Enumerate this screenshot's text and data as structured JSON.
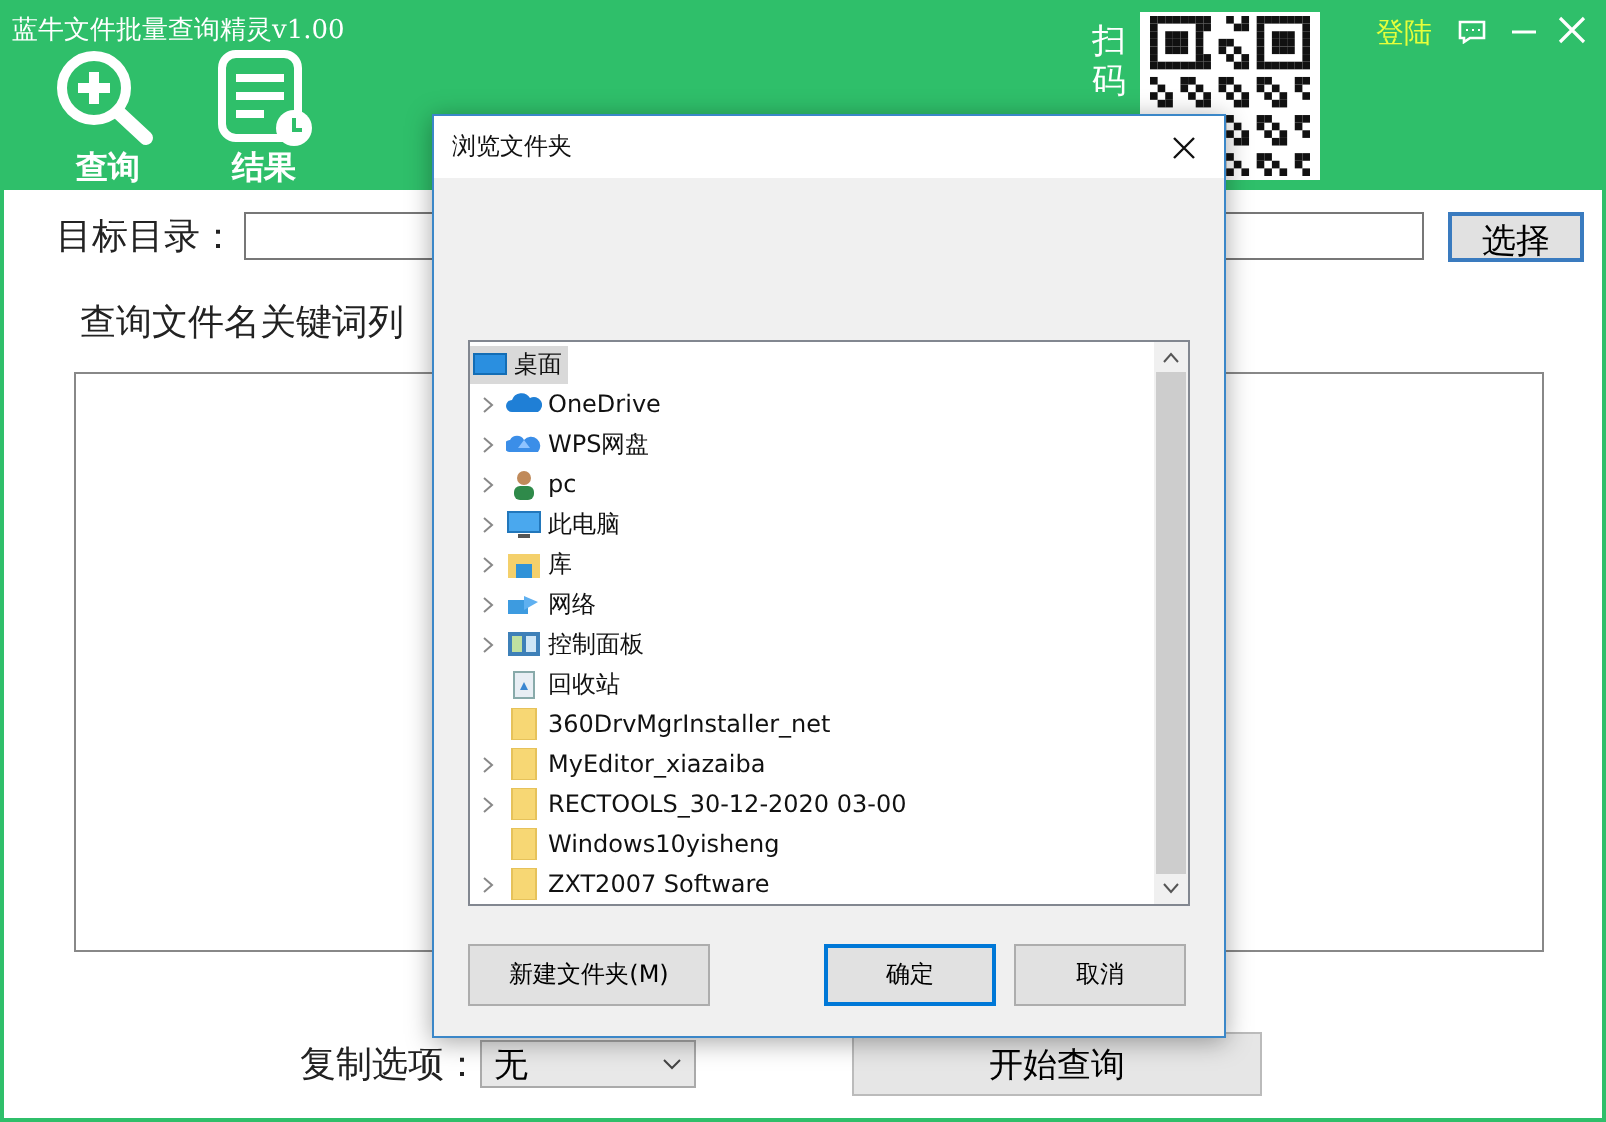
{
  "window": {
    "title": "蓝牛文件批量查询精灵v1.00",
    "login": "登陆"
  },
  "toolbar": [
    {
      "label": "查询",
      "kind": "search"
    },
    {
      "label": "结果",
      "kind": "result"
    }
  ],
  "qr_caption": "扫码",
  "target": {
    "label": "目标目录：",
    "button": "选择"
  },
  "keywords_label": "查询文件名关键词列",
  "copy_option": {
    "label": "复制选项：",
    "value": "无"
  },
  "start_button": "开始查询",
  "dialog": {
    "title": "浏览文件夹",
    "tree": {
      "label": "桌面",
      "kind": "desktop",
      "selected": true,
      "children": [
        {
          "label": "OneDrive",
          "kind": "cloud",
          "expandable": true,
          "selected": false
        },
        {
          "label": "WPS网盘",
          "kind": "cloud2",
          "expandable": true,
          "selected": false
        },
        {
          "label": "pc",
          "kind": "user",
          "expandable": true,
          "selected": false
        },
        {
          "label": "此电脑",
          "kind": "monitor",
          "expandable": true,
          "selected": false
        },
        {
          "label": "库",
          "kind": "library",
          "expandable": true,
          "selected": false
        },
        {
          "label": "网络",
          "kind": "network",
          "expandable": true,
          "selected": false
        },
        {
          "label": "控制面板",
          "kind": "panel",
          "expandable": true,
          "selected": false
        },
        {
          "label": "回收站",
          "kind": "bin",
          "expandable": false,
          "selected": false
        },
        {
          "label": "360DrvMgrInstaller_net",
          "kind": "folder",
          "expandable": false,
          "selected": false
        },
        {
          "label": "MyEditor_xiazaiba",
          "kind": "folder",
          "expandable": true,
          "selected": false
        },
        {
          "label": "RECTOOLS_30-12-2020 03-00",
          "kind": "folder",
          "expandable": true,
          "selected": false
        },
        {
          "label": "Windows10yisheng",
          "kind": "folder",
          "expandable": false,
          "selected": false
        },
        {
          "label": "ZXT2007 Software",
          "kind": "folder",
          "expandable": true,
          "selected": false
        }
      ]
    },
    "buttons": [
      {
        "label": "新建文件夹(M)",
        "default": false
      },
      {
        "label": "确定",
        "default": true
      },
      {
        "label": "取消",
        "default": false
      }
    ]
  }
}
